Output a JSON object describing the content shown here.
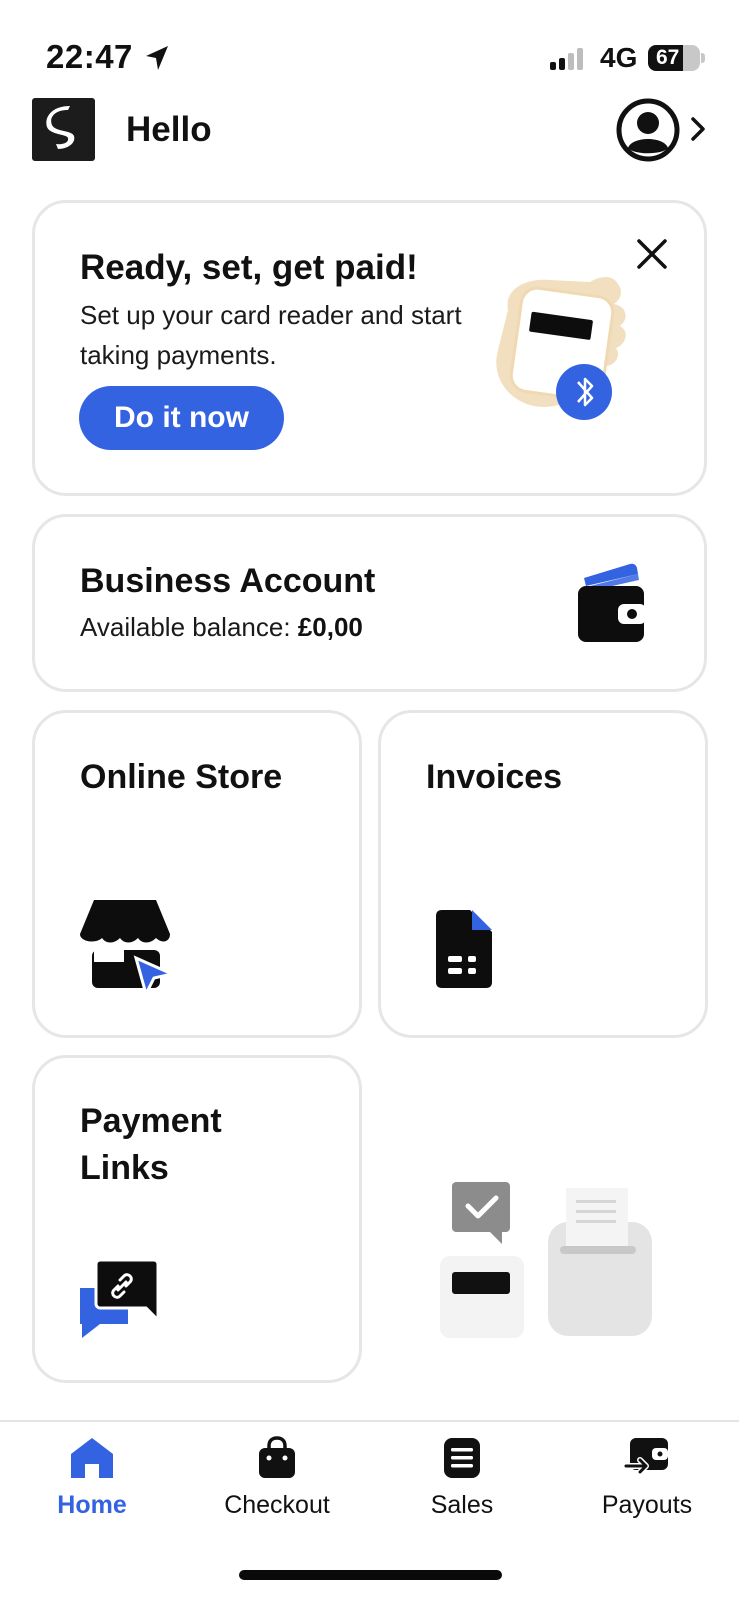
{
  "status_bar": {
    "time": "22:47",
    "network": "4G",
    "battery": "67"
  },
  "header": {
    "greeting": "Hello"
  },
  "promo": {
    "title": "Ready, set, get paid!",
    "text": "Set up your card reader and start taking payments.",
    "cta": "Do it now"
  },
  "business_account": {
    "title": "Business Account",
    "balance_label": "Available balance:",
    "balance_value": "£0,00"
  },
  "tiles": {
    "online_store": "Online Store",
    "invoices": "Invoices",
    "payment_links": "Payment Links"
  },
  "nav": {
    "items": [
      {
        "label": "Home",
        "icon": "home-icon",
        "active": true
      },
      {
        "label": "Checkout",
        "icon": "bag-icon",
        "active": false
      },
      {
        "label": "Sales",
        "icon": "list-icon",
        "active": false
      },
      {
        "label": "Payouts",
        "icon": "payout-wallet-icon",
        "active": false
      }
    ]
  },
  "colors": {
    "accent": "#3463e2",
    "border": "#e6e6e6",
    "text": "#111111"
  }
}
